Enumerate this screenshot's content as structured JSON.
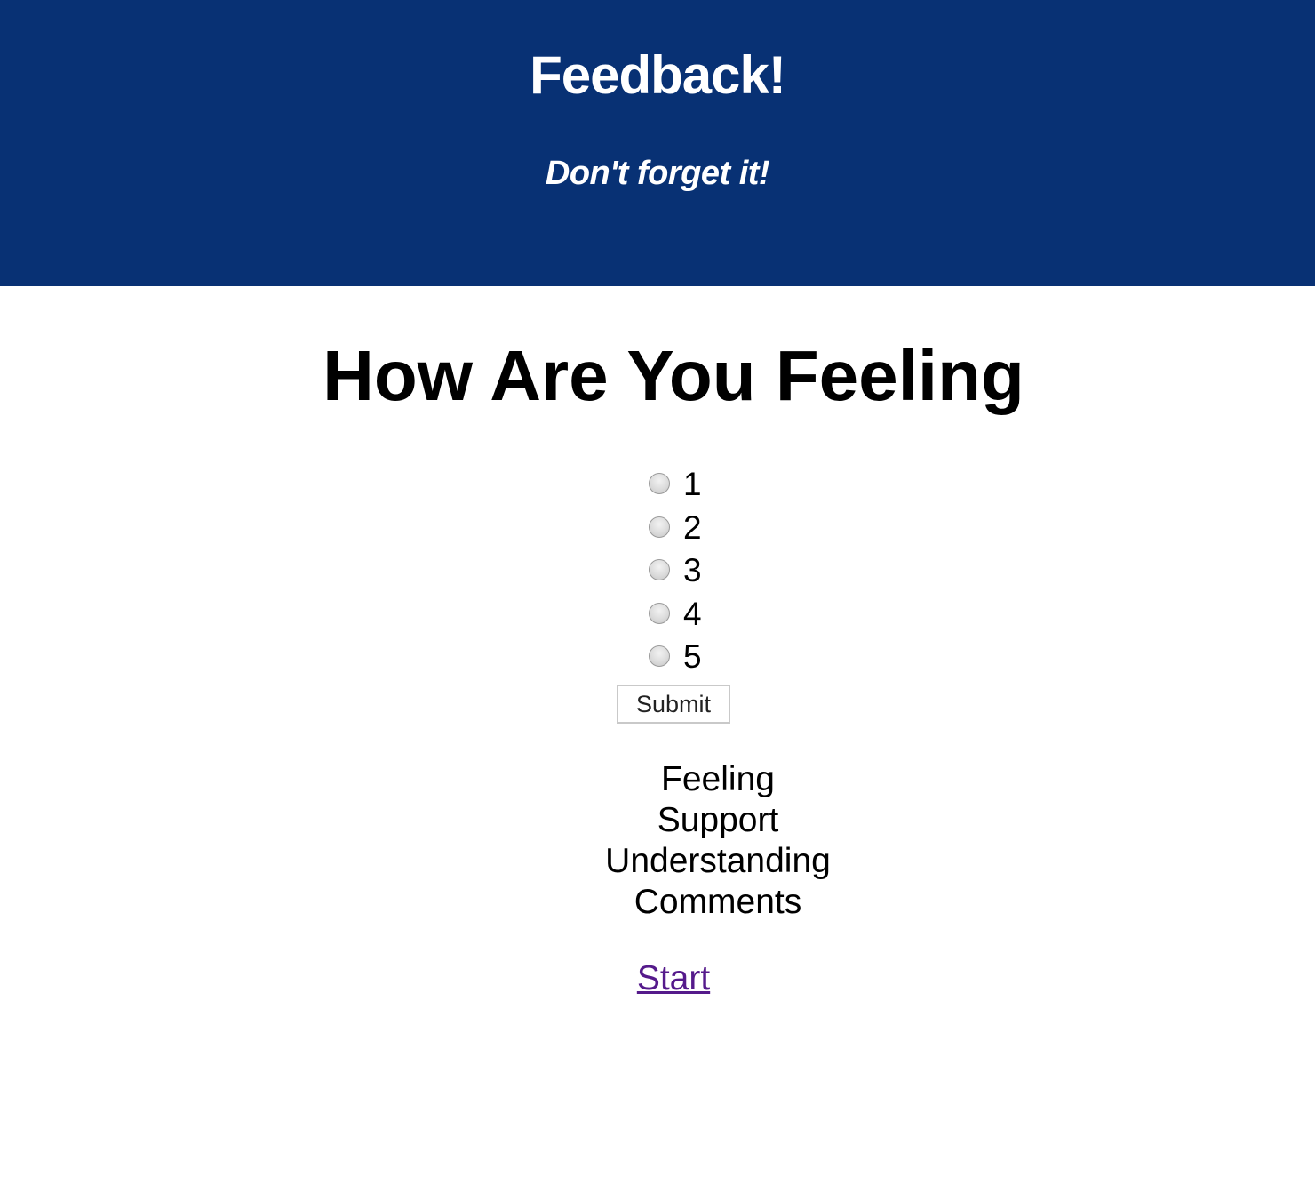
{
  "header": {
    "title": "Feedback!",
    "subtitle": "Don't forget it!",
    "background": "#083174"
  },
  "main": {
    "heading": "How Are You Feeling",
    "options": [
      {
        "label": "1",
        "selected": false
      },
      {
        "label": "2",
        "selected": false
      },
      {
        "label": "3",
        "selected": false
      },
      {
        "label": "4",
        "selected": false
      },
      {
        "label": "5",
        "selected": false
      }
    ],
    "submit_label": "Submit",
    "categories": [
      "Feeling",
      "Support",
      "Understanding",
      "Comments"
    ],
    "start_link": "Start",
    "link_color": "#551a8b"
  }
}
